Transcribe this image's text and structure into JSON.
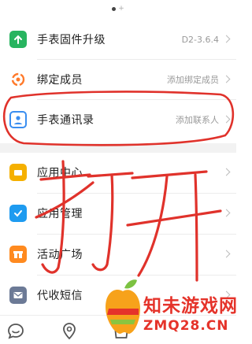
{
  "menu": {
    "group1": [
      {
        "label": "手表固件升级",
        "value": "D2-3.6.4",
        "icon": "upload-arrow-icon",
        "color": "#27b45f"
      },
      {
        "label": "绑定成员",
        "value": "添加绑定成员",
        "icon": "members-icon",
        "color": "#ff7a2b"
      },
      {
        "label": "手表通讯录",
        "value": "添加联系人",
        "icon": "contact-card-icon",
        "color": "#3a8ef0"
      }
    ],
    "group2": [
      {
        "label": "应用中心",
        "value": "",
        "icon": "folder-icon",
        "color": "#f5b000"
      },
      {
        "label": "应用管理",
        "value": "",
        "icon": "check-box-icon",
        "color": "#1e9bf0"
      },
      {
        "label": "活动广场",
        "value": "",
        "icon": "gift-icon",
        "color": "#ff8a1f"
      },
      {
        "label": "代收短信",
        "value": "",
        "icon": "mail-icon",
        "color": "#6c7a96"
      }
    ]
  },
  "annotation": {
    "handwriting": "打开",
    "color": "#e0322b"
  },
  "watermark": {
    "title": "知未游戏网",
    "url": "ZMQ28.CN"
  },
  "bottom_nav": {
    "icons": [
      "chat-icon",
      "location-icon",
      "store-icon"
    ]
  }
}
